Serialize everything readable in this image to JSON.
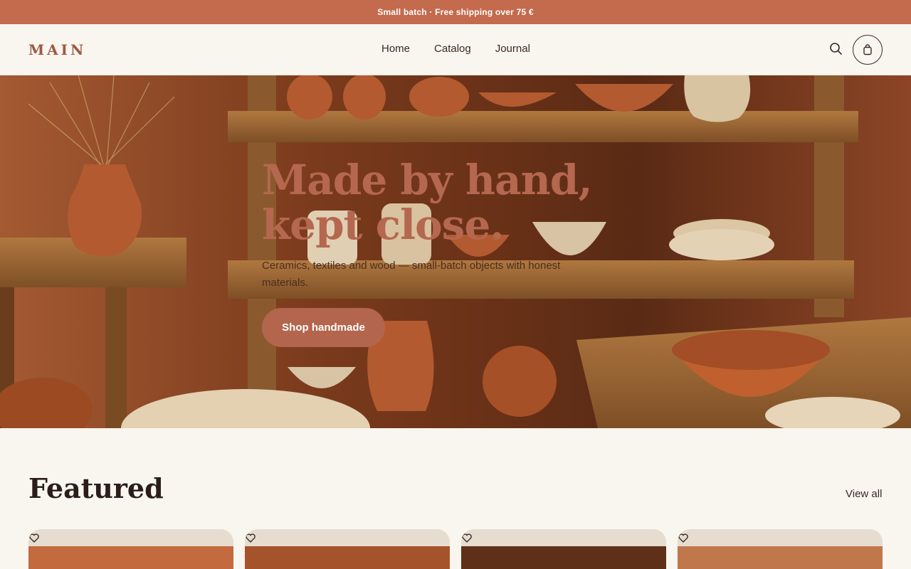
{
  "announcement": "Small batch · Free shipping over 75 €",
  "header": {
    "logo": "MAIN",
    "nav": [
      "Home",
      "Catalog",
      "Journal"
    ],
    "search_icon": "search-icon",
    "cart_icon": "shopping-bag-icon"
  },
  "hero": {
    "title": "Made by hand, kept close.",
    "subtitle": "Ceramics, textiles and wood — small-batch objects with honest materials.",
    "cta": "Shop handmade"
  },
  "featured": {
    "title": "Featured",
    "view_all": "View all",
    "cards": [
      {
        "icon": "heart-icon",
        "color": "#c46a3f"
      },
      {
        "icon": "heart-icon",
        "color": "#a4532b"
      },
      {
        "icon": "heart-icon",
        "color": "#5e3018"
      },
      {
        "icon": "heart-icon",
        "color": "#c1774c"
      }
    ]
  },
  "colors": {
    "accent": "#c46a4d",
    "button": "#b4654d",
    "background": "#f9f5ef"
  }
}
